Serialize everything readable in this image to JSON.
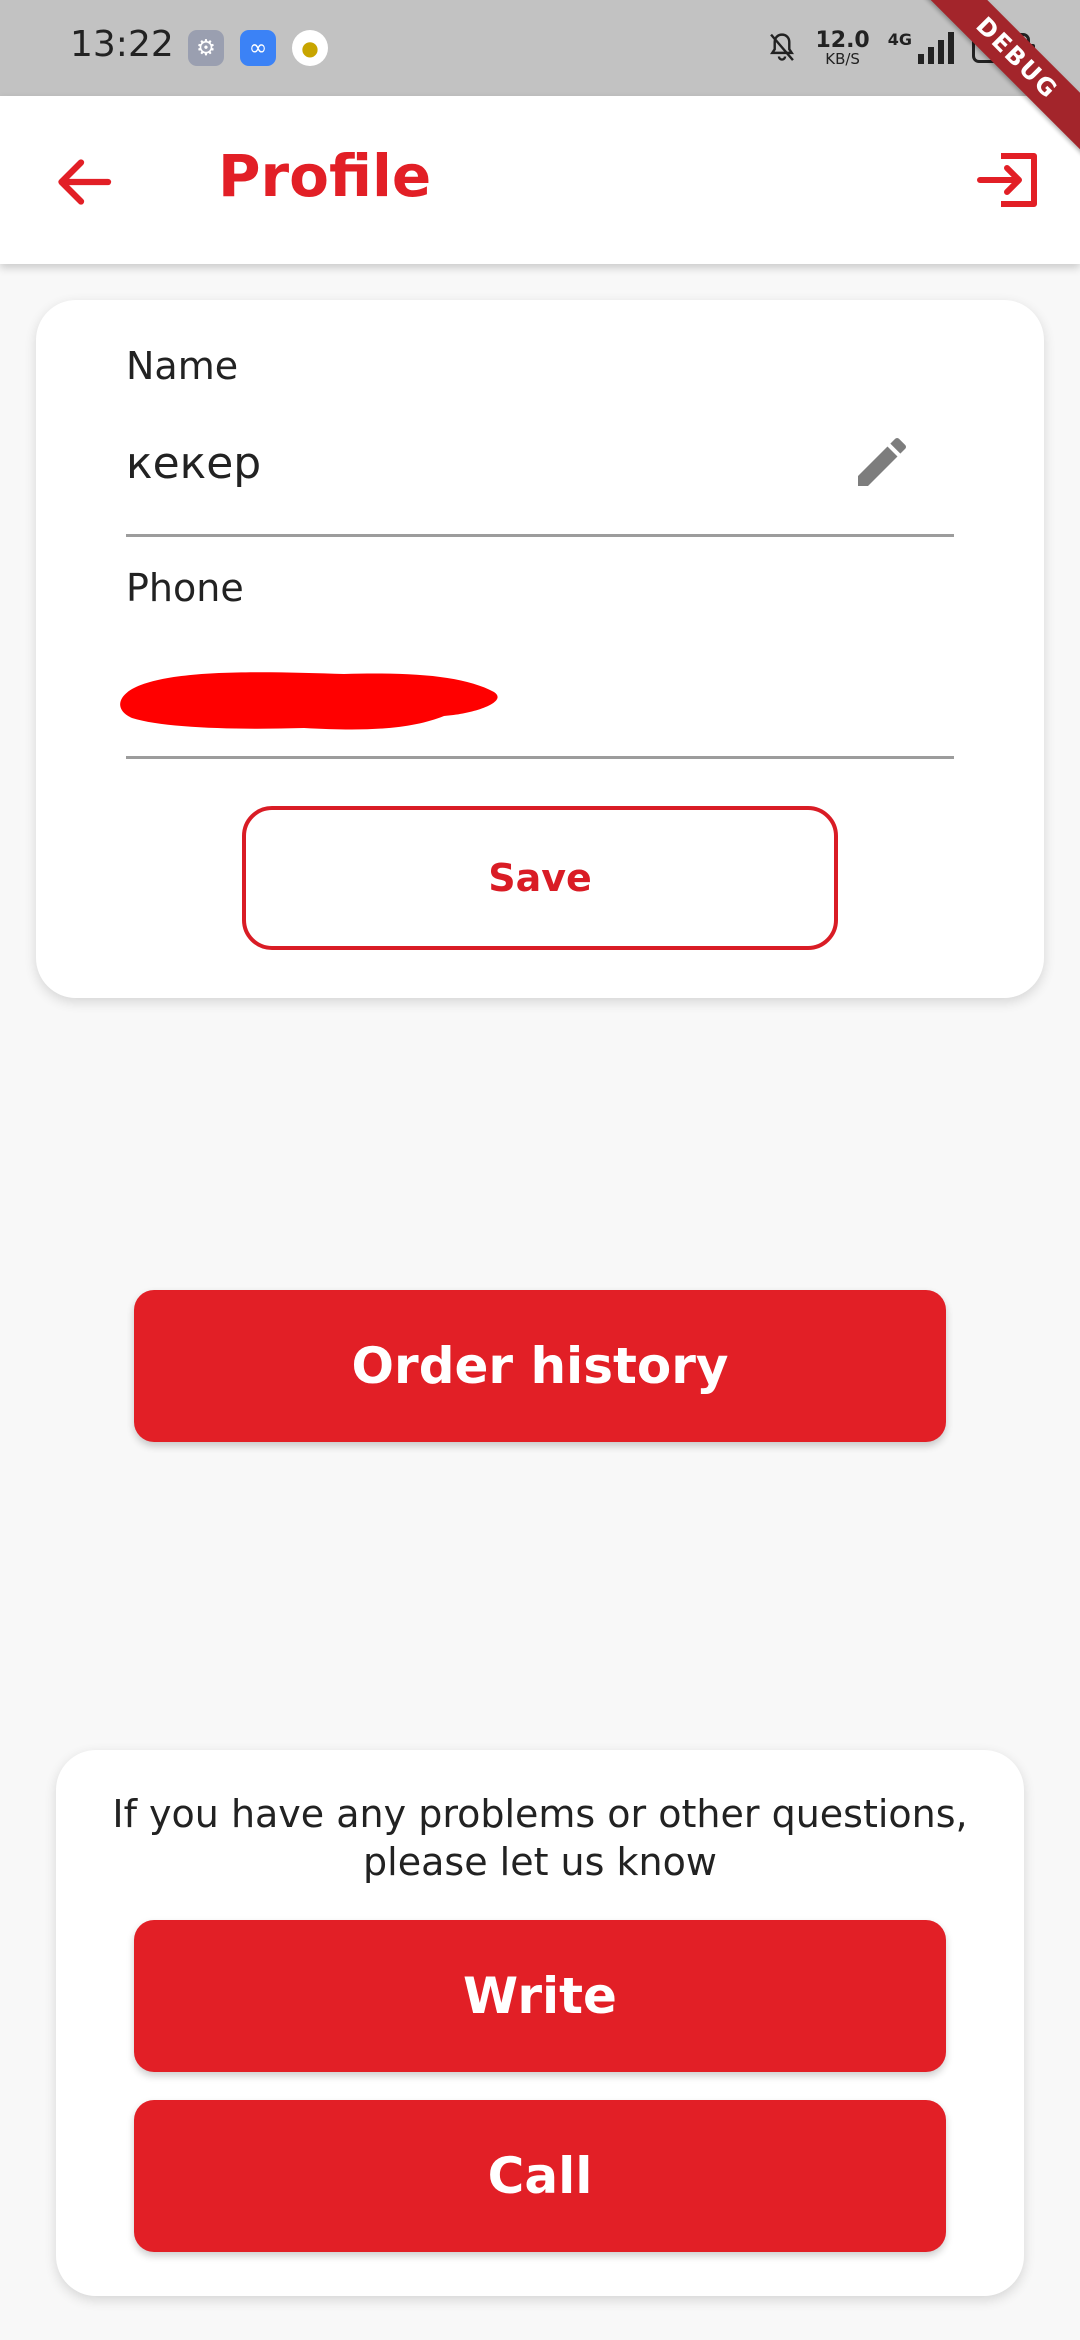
{
  "status_bar": {
    "time": "13:22",
    "net_speed_value": "12.0",
    "net_speed_unit": "KB/S",
    "network": "4G",
    "battery": "100"
  },
  "debug_banner": "DEBUG",
  "app_bar": {
    "title": "Profile",
    "back_icon": "arrow-left-icon",
    "logout_icon": "logout-icon"
  },
  "profile": {
    "name_label": "Name",
    "name_value": "кекер",
    "phone_label": "Phone",
    "phone_value": "",
    "save_label": "Save",
    "edit_icon": "pencil-icon"
  },
  "order_history_label": "Order history",
  "support": {
    "message_line_1": "If you have any problems or other questions,",
    "message_line_2": "please let us know",
    "write_label": "Write",
    "call_label": "Call"
  },
  "colors": {
    "accent": "#e21f26",
    "status_bar": "#c2c2c2",
    "background": "#f8f8f8"
  }
}
